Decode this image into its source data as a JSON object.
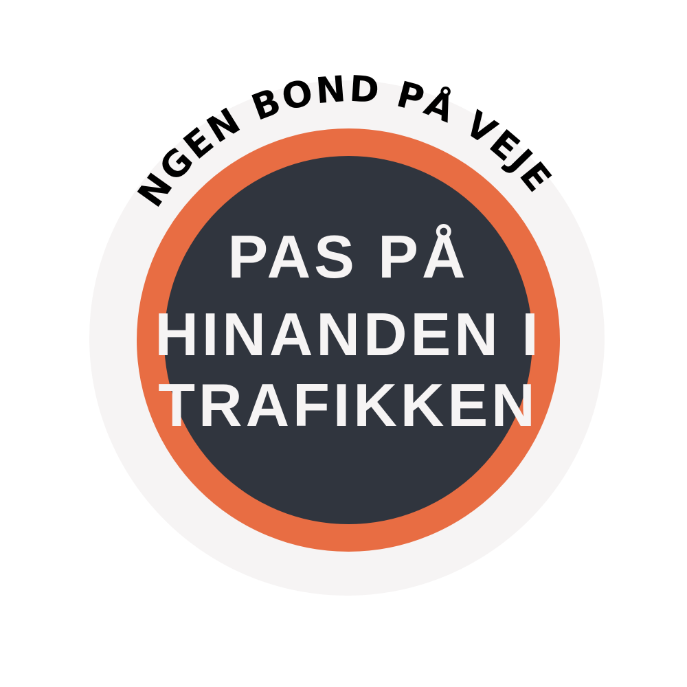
{
  "badge": {
    "arc_text": "INGEN BOND PÅ VEJEN",
    "lines": [
      "PAS PÅ",
      "HINANDEN I",
      "TRAFIKKEN"
    ],
    "colors": {
      "background": "#ffffff",
      "outer_disc": "#f6f4f4",
      "ring": "#e86d43",
      "inner_disc": "#30353e",
      "inner_text": "#f6f4f4",
      "arc_text": "#000000"
    }
  }
}
